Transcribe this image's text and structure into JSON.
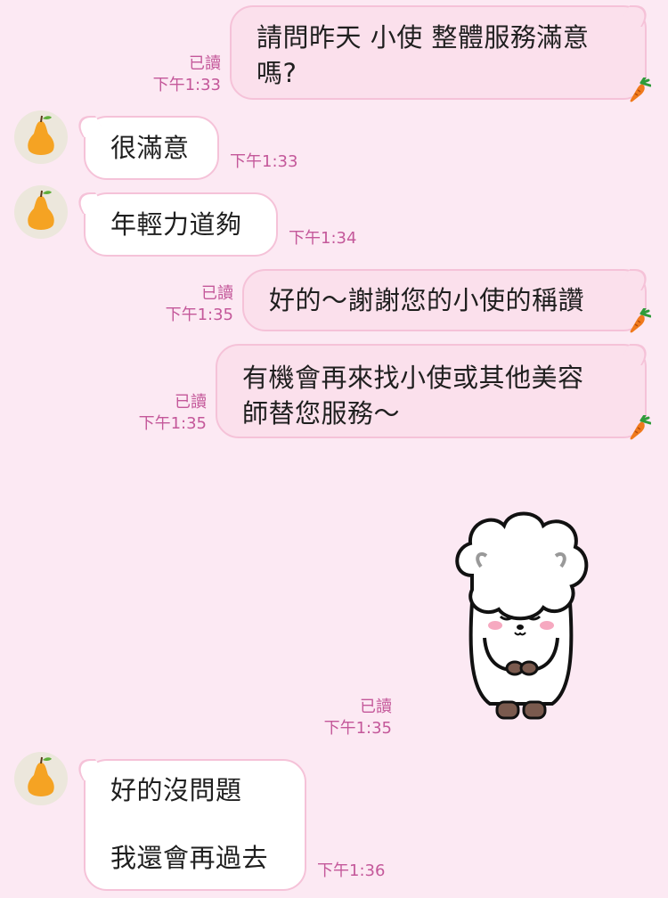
{
  "messages": [
    {
      "text": "請問昨天 小使 整體服務滿意\n嗎?",
      "read": "已讀",
      "time": "下午1:33"
    },
    {
      "text": "很滿意",
      "time": "下午1:33"
    },
    {
      "text": "年輕力道夠",
      "time": "下午1:34"
    },
    {
      "text": "好的～謝謝您的小使的稱讚",
      "read": "已讀",
      "time": "下午1:35"
    },
    {
      "text": "有機會再來找小使或其他美容\n師替您服務～",
      "read": "已讀",
      "time": "下午1:35"
    },
    {
      "read": "已讀",
      "time": "下午1:35"
    },
    {
      "text": "好的沒問題\n\n我還會再過去",
      "time": "下午1:36"
    }
  ],
  "icons": {
    "avatar": "pear-avatar-icon",
    "sent_marker": "carrot-icon",
    "sticker": "bowing-sheep-sticker"
  },
  "colors": {
    "background": "#fce9f3",
    "outgoing_bubble": "#fbe0ec",
    "incoming_bubble": "#ffffff",
    "bubble_border": "#f5c2d8",
    "meta_text": "#c4589a"
  }
}
